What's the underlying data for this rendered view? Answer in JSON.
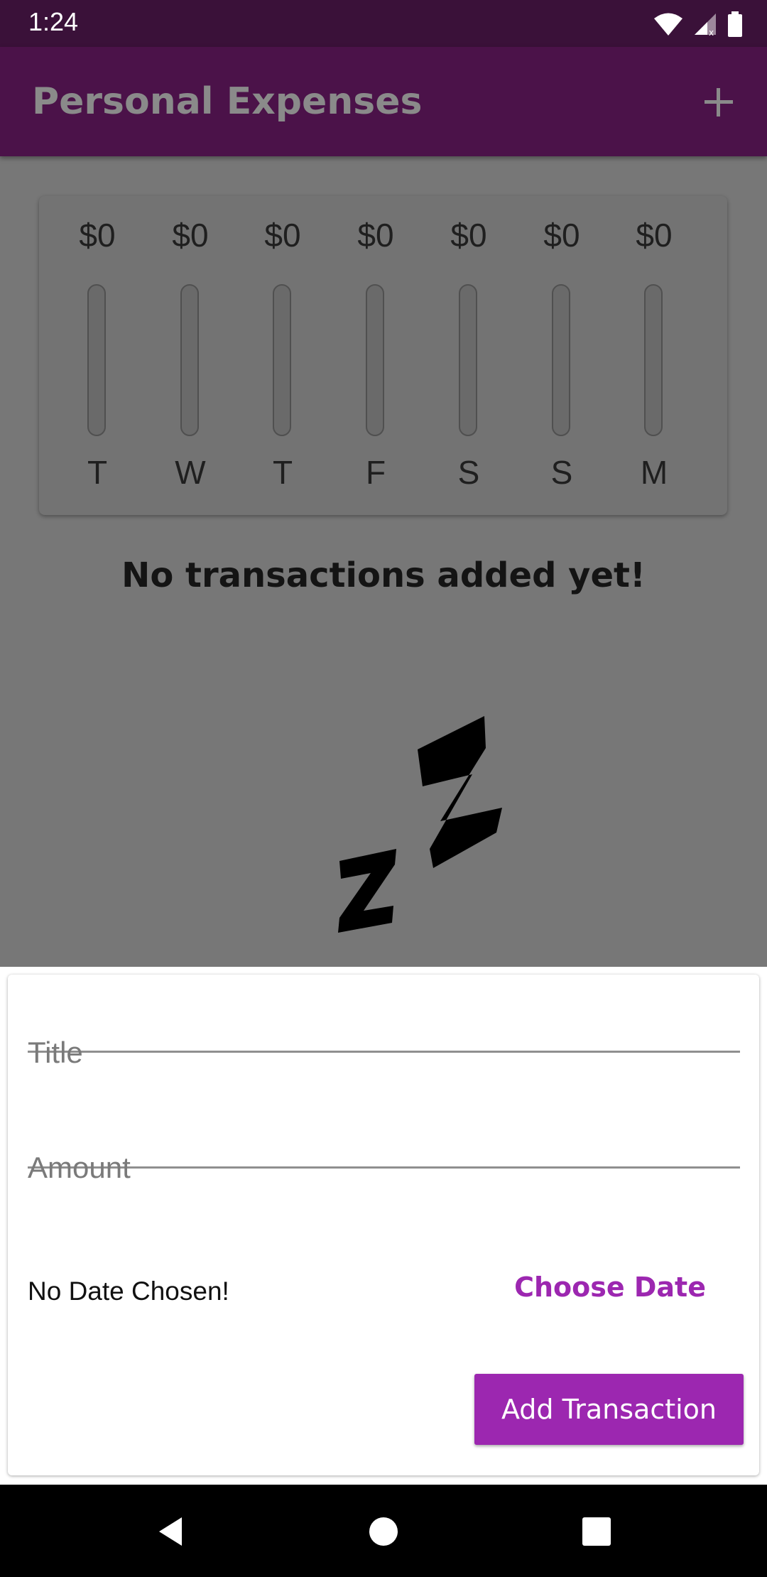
{
  "status_bar": {
    "time": "1:24",
    "icons": [
      "wifi-icon",
      "cell-signal-icon",
      "battery-icon"
    ]
  },
  "app_bar": {
    "title": "Personal Expenses",
    "add_icon": "plus-icon"
  },
  "chart": {
    "bars": [
      {
        "amount": "$0",
        "day": "T",
        "fill_fraction": 0
      },
      {
        "amount": "$0",
        "day": "W",
        "fill_fraction": 0
      },
      {
        "amount": "$0",
        "day": "T",
        "fill_fraction": 0
      },
      {
        "amount": "$0",
        "day": "F",
        "fill_fraction": 0
      },
      {
        "amount": "$0",
        "day": "S",
        "fill_fraction": 0
      },
      {
        "amount": "$0",
        "day": "S",
        "fill_fraction": 0
      },
      {
        "amount": "$0",
        "day": "M",
        "fill_fraction": 0
      }
    ]
  },
  "empty_state": {
    "message": "No transactions added yet!",
    "image": "sleeping-zz-icon"
  },
  "new_transaction": {
    "title_placeholder": "Title",
    "amount_placeholder": "Amount",
    "date_text": "No Date Chosen!",
    "choose_date_label": "Choose Date",
    "submit_label": "Add Transaction"
  },
  "nav_bar": {
    "icons": [
      "back-icon",
      "home-icon",
      "recents-icon"
    ]
  },
  "colors": {
    "app_bar": "#4b1249",
    "status_bar": "#3a1139",
    "accent": "#9c27b0",
    "scrim": "#777777"
  }
}
